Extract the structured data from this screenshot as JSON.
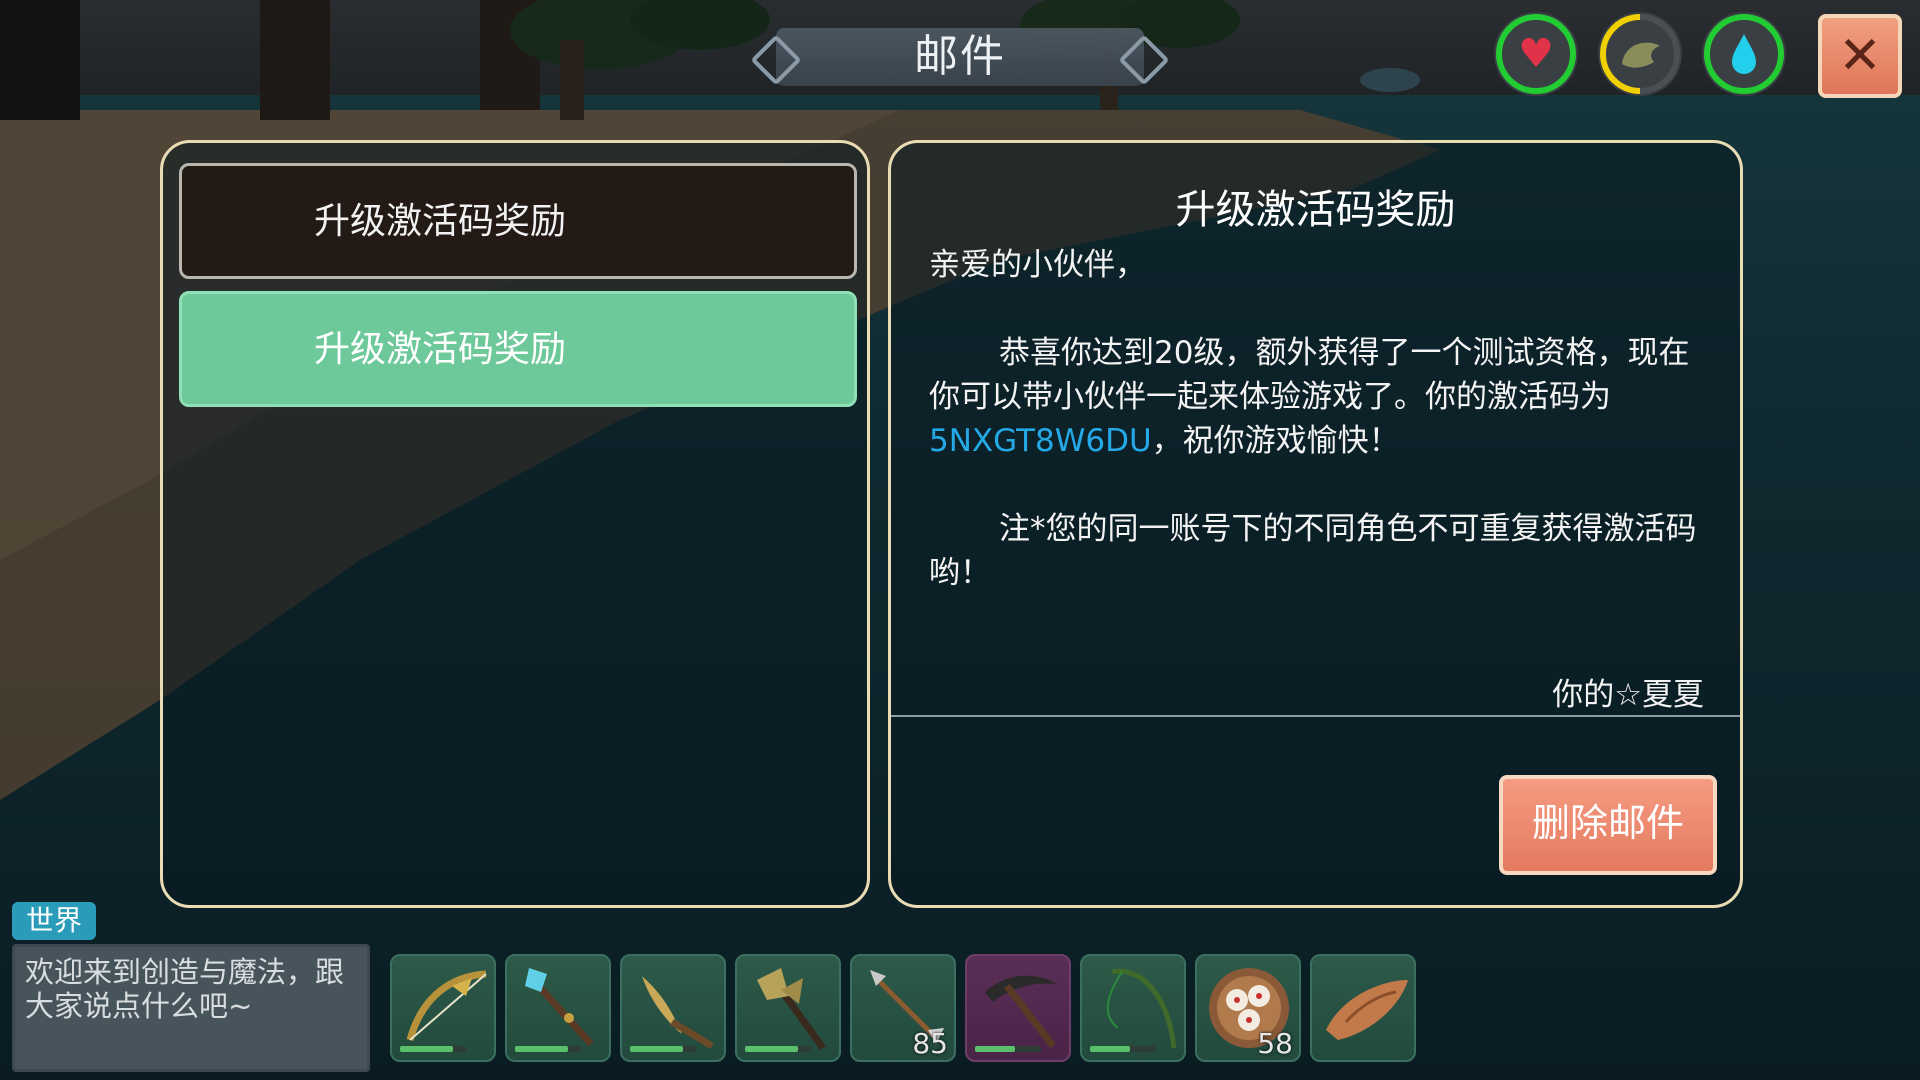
{
  "header": {
    "title": "邮件",
    "status_icons": [
      {
        "name": "health-icon",
        "glyph": "♥",
        "color": "#e0334a",
        "ring": "#22cc33",
        "fill": 1.0
      },
      {
        "name": "hunger-icon",
        "glyph": "⬮",
        "color": "#8a8c5a",
        "ring": "#f0d000",
        "fill": 0.5
      },
      {
        "name": "water-icon",
        "glyph": "💧",
        "color": "#22d0ee",
        "ring": "#22cc33",
        "fill": 1.0
      }
    ],
    "close_icon": "✕"
  },
  "mail_list": {
    "items": [
      {
        "label": "升级激活码奖励",
        "selected": false
      },
      {
        "label": "升级激活码奖励",
        "selected": true
      }
    ]
  },
  "mail_detail": {
    "title": "升级激活码奖励",
    "greeting": "亲爱的小伙伴，",
    "para1_prefix": "恭喜你达到20级，额外获得了一个测试资格，现在你可以带小伙伴一起来体验游戏了。你的激活码为",
    "code": "5NXGT8W6DU",
    "para1_suffix": "，祝你游戏愉快！",
    "note": "注*您的同一账号下的不同角色不可重复获得激活码哟！",
    "signature": "你的☆夏夏",
    "delete_button": "删除邮件"
  },
  "chat": {
    "tab": "世界",
    "placeholder": "欢迎来到创造与魔法，跟大家说点什么吧~"
  },
  "hotbar": [
    {
      "name": "bow-icon",
      "durability": 0.8,
      "count": ""
    },
    {
      "name": "crystal-staff-icon",
      "durability": 0.8,
      "count": ""
    },
    {
      "name": "scythe-icon",
      "durability": 0.8,
      "count": ""
    },
    {
      "name": "battle-axe-icon",
      "durability": 0.8,
      "count": ""
    },
    {
      "name": "arrow-icon",
      "durability": null,
      "count": "85"
    },
    {
      "name": "pickaxe-icon",
      "durability": 0.6,
      "count": ""
    },
    {
      "name": "fishing-rod-icon",
      "durability": 0.6,
      "count": ""
    },
    {
      "name": "steamed-buns-icon",
      "durability": null,
      "count": "58"
    },
    {
      "name": "wooden-boat-icon",
      "durability": null,
      "count": ""
    }
  ]
}
